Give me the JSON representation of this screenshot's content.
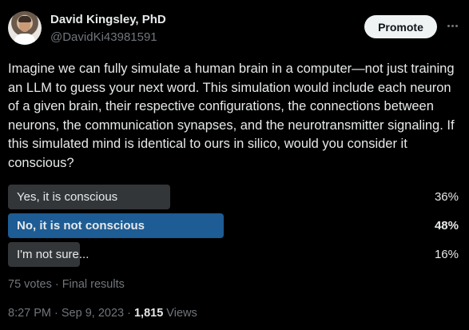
{
  "author": {
    "name": "David Kingsley, PhD",
    "handle": "@DavidKi43981591"
  },
  "header": {
    "promote_label": "Promote",
    "more_icon": "more-horizontal-icon"
  },
  "tweet": {
    "text": "Imagine we can fully simulate a human brain in a computer—not just training an LLM to guess your next word. This simulation would include each neuron of a given brain, their respective configurations, the connections between neurons, the communication synapses, and the neurotransmitter signaling. If this simulated mind is identical to ours in silico, would you consider it conscious?"
  },
  "poll": {
    "options": [
      {
        "label": "Yes, it is conscious",
        "percent": "36%",
        "share": 0.36,
        "winner": false
      },
      {
        "label": "No, it is not conscious",
        "percent": "48%",
        "share": 0.48,
        "winner": true
      },
      {
        "label": "I'm not sure...",
        "percent": "16%",
        "share": 0.16,
        "winner": false
      }
    ],
    "meta": "75 votes · Final results"
  },
  "footer": {
    "time": "8:27 PM · Sep 9, 2023 · ",
    "views_count": "1,815",
    "views_label": " Views"
  },
  "colors": {
    "background": "#000000",
    "text": "#e7e9ea",
    "muted": "#71767b",
    "poll_bar": "#333639",
    "poll_winner": "#1d5c94"
  }
}
